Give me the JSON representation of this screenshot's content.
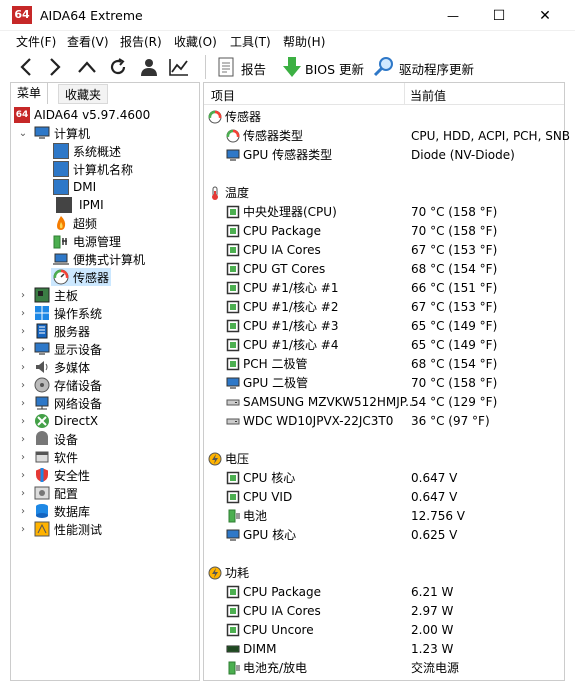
{
  "window": {
    "app_icon_text": "64",
    "title": "AIDA64 Extreme",
    "minimize_glyph": "—",
    "maximize_glyph": "☐",
    "close_glyph": "✕"
  },
  "menubar": {
    "items": [
      "文件(F)",
      "查看(V)",
      "报告(R)",
      "收藏(O)",
      "工具(T)",
      "帮助(H)"
    ]
  },
  "toolbar": {
    "icons": [
      "back-arrow-icon",
      "forward-arrow-icon",
      "up-arrow-icon",
      "refresh-icon",
      "user-icon",
      "chart-icon"
    ],
    "report_label": "报告",
    "bios_label": "BIOS 更新",
    "driver_label": "驱动程序更新"
  },
  "left_panel": {
    "tabs": [
      "菜单",
      "收藏夹"
    ],
    "root": "AIDA64 v5.97.4600",
    "computer": {
      "label": "计算机",
      "children": [
        "系统概述",
        "计算机名称",
        "DMI",
        "IPMI",
        "超频",
        "电源管理",
        "便携式计算机",
        "传感器"
      ]
    },
    "categories": [
      "主板",
      "操作系统",
      "服务器",
      "显示设备",
      "多媒体",
      "存储设备",
      "网络设备",
      "DirectX",
      "设备",
      "软件",
      "安全性",
      "配置",
      "数据库",
      "性能测试"
    ]
  },
  "right_panel": {
    "col_item": "项目",
    "col_value": "当前值",
    "sections": [
      {
        "title": "传感器",
        "rows": [
          {
            "label": "传感器类型",
            "value": "CPU, HDD, ACPI, PCH, SNB"
          },
          {
            "label": "GPU 传感器类型",
            "value": "Diode  (NV-Diode)"
          }
        ]
      },
      {
        "title": "温度",
        "rows": [
          {
            "label": "中央处理器(CPU)",
            "value": "70 °C  (158 °F)"
          },
          {
            "label": "CPU Package",
            "value": "70 °C  (158 °F)"
          },
          {
            "label": "CPU IA Cores",
            "value": "67 °C  (153 °F)"
          },
          {
            "label": "CPU GT Cores",
            "value": "68 °C  (154 °F)"
          },
          {
            "label": "CPU #1/核心 #1",
            "value": "66 °C  (151 °F)"
          },
          {
            "label": "CPU #1/核心 #2",
            "value": "67 °C  (153 °F)"
          },
          {
            "label": "CPU #1/核心 #3",
            "value": "65 °C  (149 °F)"
          },
          {
            "label": "CPU #1/核心 #4",
            "value": "65 °C  (149 °F)"
          },
          {
            "label": "PCH 二极管",
            "value": "68 °C  (154 °F)"
          },
          {
            "label": "GPU 二极管",
            "value": "70 °C  (158 °F)"
          },
          {
            "label": "SAMSUNG MZVKW512HMJP...",
            "value": "54 °C  (129 °F)"
          },
          {
            "label": "WDC WD10JPVX-22JC3T0",
            "value": "36 °C  (97 °F)"
          }
        ]
      },
      {
        "title": "电压",
        "rows": [
          {
            "label": "CPU 核心",
            "value": "0.647 V"
          },
          {
            "label": "CPU VID",
            "value": "0.647 V"
          },
          {
            "label": "电池",
            "value": "12.756 V"
          },
          {
            "label": "GPU 核心",
            "value": "0.625 V"
          }
        ]
      },
      {
        "title": "功耗",
        "rows": [
          {
            "label": "CPU Package",
            "value": "6.21 W"
          },
          {
            "label": "CPU IA Cores",
            "value": "2.97 W"
          },
          {
            "label": "CPU Uncore",
            "value": "2.00 W"
          },
          {
            "label": "DIMM",
            "value": "1.23 W"
          },
          {
            "label": "电池充/放电",
            "value": "交流电源"
          }
        ]
      }
    ]
  }
}
